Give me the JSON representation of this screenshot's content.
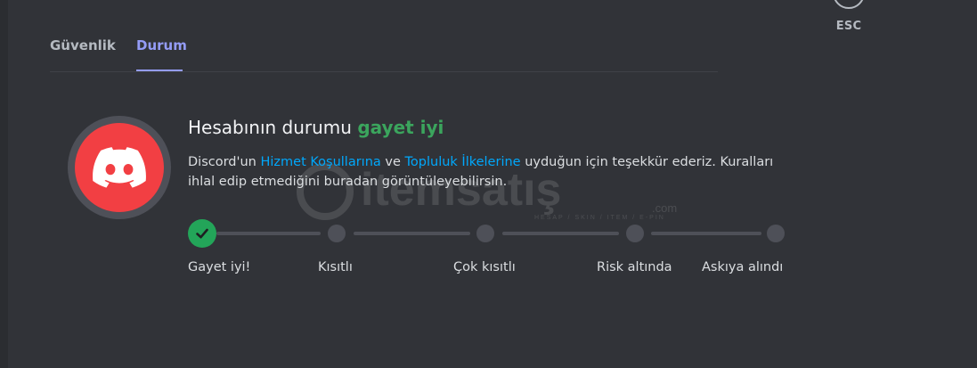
{
  "window": {
    "esc_label": "ESC"
  },
  "tabs": [
    {
      "label": "Güvenlik",
      "active": false
    },
    {
      "label": "Durum",
      "active": true
    }
  ],
  "account_status": {
    "heading_prefix": "Hesabının durumu",
    "status_word": "gayet iyi",
    "desc_part1": "Discord'un",
    "tos_link": "Hizmet Koşullarına",
    "desc_part2": "ve",
    "guidelines_link": "Topluluk İlkelerine",
    "desc_part3": "uyduğun için teşekkür ederiz. Kuralları ihlal edip etmediğini buradan görüntüleyebilirsin."
  },
  "steps": [
    {
      "label": "Gayet iyi!",
      "active": true
    },
    {
      "label": "Kısıtlı",
      "active": false
    },
    {
      "label": "Çok kısıtlı",
      "active": false
    },
    {
      "label": "Risk altında",
      "active": false
    },
    {
      "label": "Askıya alındı",
      "active": false
    }
  ],
  "watermark": {
    "brand": "itemsatış",
    "sub": "HESAP / SKIN / ITEM / E-PIN",
    "tld": ".com"
  },
  "colors": {
    "background": "#313338",
    "accent": "#949cf7",
    "success": "#23a559",
    "avatar": "#f23f43",
    "link": "#00a8fc"
  },
  "icons": {
    "avatar": "discord-logo-icon",
    "active_step": "checkmark-icon"
  }
}
